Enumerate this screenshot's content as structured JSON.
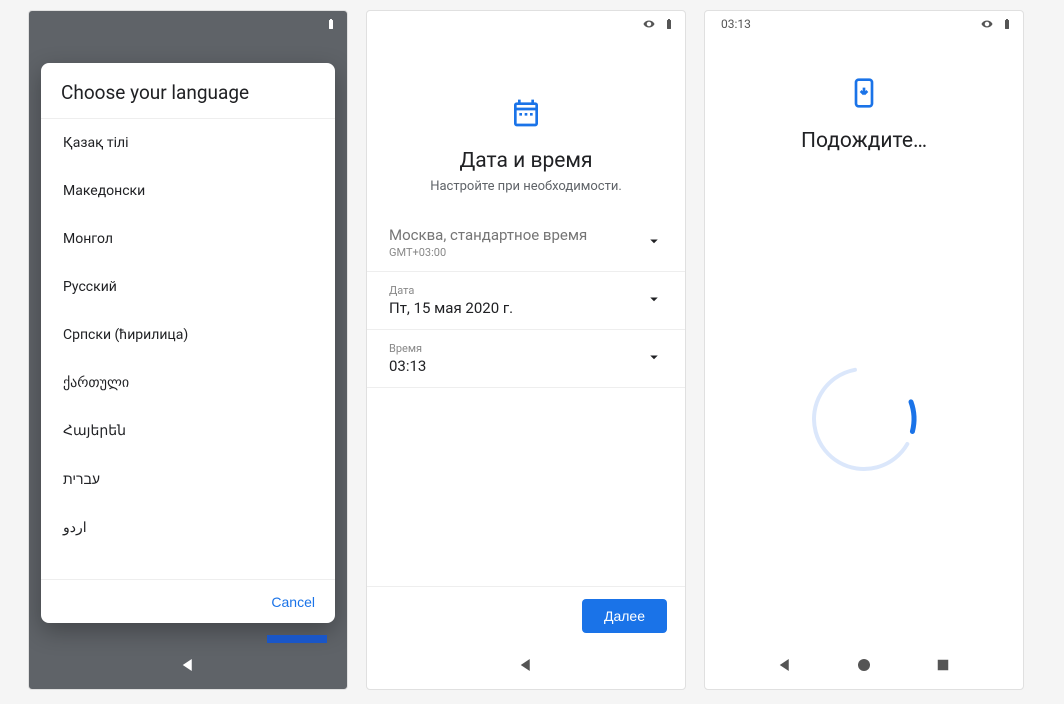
{
  "screen1": {
    "title": "Choose your language",
    "languages": [
      "Қазақ тілі",
      "Македонски",
      "Монгол",
      "Русский",
      "Српски (ћирилица)",
      "ქართული",
      "Հայերեն",
      "עברית",
      "اردو"
    ],
    "cancel": "Cancel"
  },
  "screen2": {
    "title": "Дата и время",
    "subtitle": "Настройте при необходимости.",
    "timezone": {
      "value": "Москва, стандартное время",
      "sub": "GMT+03:00"
    },
    "date": {
      "label": "Дата",
      "value": "Пт, 15 мая 2020 г."
    },
    "time": {
      "label": "Время",
      "value": "03:13"
    },
    "next": "Далее"
  },
  "screen3": {
    "statusTime": "03:13",
    "title": "Подождите…"
  }
}
